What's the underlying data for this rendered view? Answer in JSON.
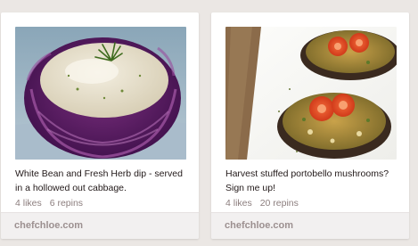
{
  "pins": [
    {
      "description": "White Bean and Fresh Herb dip - served in a hollowed out cabbage.",
      "likes": "4 likes",
      "repins": "6 repins",
      "source": "chefchloe.com",
      "image_subject": "white-bean-dip-in-cabbage"
    },
    {
      "description": "Harvest stuffed portobello mushrooms? Sign me up!",
      "likes": "4 likes",
      "repins": "20 repins",
      "source": "chefchloe.com",
      "image_subject": "stuffed-portobello-mushrooms"
    }
  ]
}
